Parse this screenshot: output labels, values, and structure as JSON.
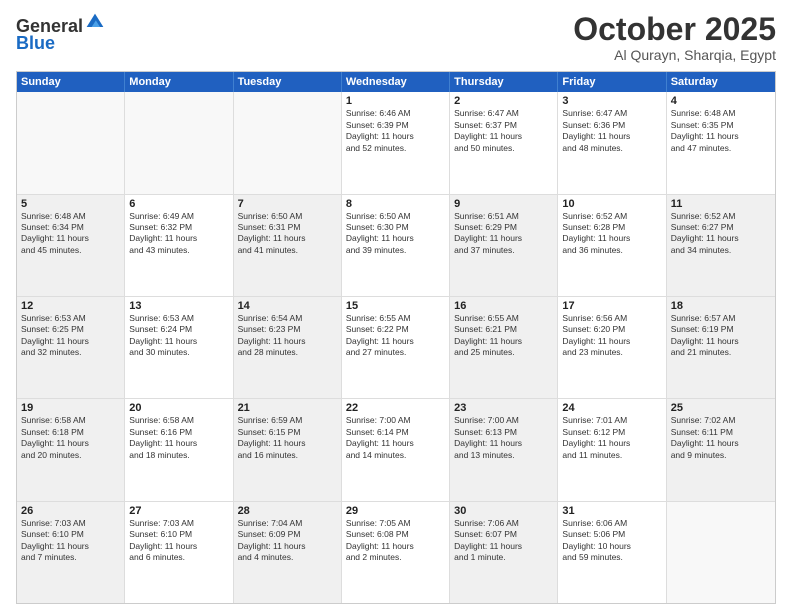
{
  "header": {
    "logo_general": "General",
    "logo_blue": "Blue",
    "month_title": "October 2025",
    "subtitle": "Al Qurayn, Sharqia, Egypt"
  },
  "calendar": {
    "days_of_week": [
      "Sunday",
      "Monday",
      "Tuesday",
      "Wednesday",
      "Thursday",
      "Friday",
      "Saturday"
    ],
    "rows": [
      [
        {
          "day": "",
          "info": "",
          "empty": true
        },
        {
          "day": "",
          "info": "",
          "empty": true
        },
        {
          "day": "",
          "info": "",
          "empty": true
        },
        {
          "day": "1",
          "info": "Sunrise: 6:46 AM\nSunset: 6:39 PM\nDaylight: 11 hours\nand 52 minutes."
        },
        {
          "day": "2",
          "info": "Sunrise: 6:47 AM\nSunset: 6:37 PM\nDaylight: 11 hours\nand 50 minutes."
        },
        {
          "day": "3",
          "info": "Sunrise: 6:47 AM\nSunset: 6:36 PM\nDaylight: 11 hours\nand 48 minutes."
        },
        {
          "day": "4",
          "info": "Sunrise: 6:48 AM\nSunset: 6:35 PM\nDaylight: 11 hours\nand 47 minutes."
        }
      ],
      [
        {
          "day": "5",
          "info": "Sunrise: 6:48 AM\nSunset: 6:34 PM\nDaylight: 11 hours\nand 45 minutes.",
          "shaded": true
        },
        {
          "day": "6",
          "info": "Sunrise: 6:49 AM\nSunset: 6:32 PM\nDaylight: 11 hours\nand 43 minutes."
        },
        {
          "day": "7",
          "info": "Sunrise: 6:50 AM\nSunset: 6:31 PM\nDaylight: 11 hours\nand 41 minutes.",
          "shaded": true
        },
        {
          "day": "8",
          "info": "Sunrise: 6:50 AM\nSunset: 6:30 PM\nDaylight: 11 hours\nand 39 minutes."
        },
        {
          "day": "9",
          "info": "Sunrise: 6:51 AM\nSunset: 6:29 PM\nDaylight: 11 hours\nand 37 minutes.",
          "shaded": true
        },
        {
          "day": "10",
          "info": "Sunrise: 6:52 AM\nSunset: 6:28 PM\nDaylight: 11 hours\nand 36 minutes."
        },
        {
          "day": "11",
          "info": "Sunrise: 6:52 AM\nSunset: 6:27 PM\nDaylight: 11 hours\nand 34 minutes.",
          "shaded": true
        }
      ],
      [
        {
          "day": "12",
          "info": "Sunrise: 6:53 AM\nSunset: 6:25 PM\nDaylight: 11 hours\nand 32 minutes.",
          "shaded": true
        },
        {
          "day": "13",
          "info": "Sunrise: 6:53 AM\nSunset: 6:24 PM\nDaylight: 11 hours\nand 30 minutes."
        },
        {
          "day": "14",
          "info": "Sunrise: 6:54 AM\nSunset: 6:23 PM\nDaylight: 11 hours\nand 28 minutes.",
          "shaded": true
        },
        {
          "day": "15",
          "info": "Sunrise: 6:55 AM\nSunset: 6:22 PM\nDaylight: 11 hours\nand 27 minutes."
        },
        {
          "day": "16",
          "info": "Sunrise: 6:55 AM\nSunset: 6:21 PM\nDaylight: 11 hours\nand 25 minutes.",
          "shaded": true
        },
        {
          "day": "17",
          "info": "Sunrise: 6:56 AM\nSunset: 6:20 PM\nDaylight: 11 hours\nand 23 minutes."
        },
        {
          "day": "18",
          "info": "Sunrise: 6:57 AM\nSunset: 6:19 PM\nDaylight: 11 hours\nand 21 minutes.",
          "shaded": true
        }
      ],
      [
        {
          "day": "19",
          "info": "Sunrise: 6:58 AM\nSunset: 6:18 PM\nDaylight: 11 hours\nand 20 minutes.",
          "shaded": true
        },
        {
          "day": "20",
          "info": "Sunrise: 6:58 AM\nSunset: 6:16 PM\nDaylight: 11 hours\nand 18 minutes."
        },
        {
          "day": "21",
          "info": "Sunrise: 6:59 AM\nSunset: 6:15 PM\nDaylight: 11 hours\nand 16 minutes.",
          "shaded": true
        },
        {
          "day": "22",
          "info": "Sunrise: 7:00 AM\nSunset: 6:14 PM\nDaylight: 11 hours\nand 14 minutes."
        },
        {
          "day": "23",
          "info": "Sunrise: 7:00 AM\nSunset: 6:13 PM\nDaylight: 11 hours\nand 13 minutes.",
          "shaded": true
        },
        {
          "day": "24",
          "info": "Sunrise: 7:01 AM\nSunset: 6:12 PM\nDaylight: 11 hours\nand 11 minutes."
        },
        {
          "day": "25",
          "info": "Sunrise: 7:02 AM\nSunset: 6:11 PM\nDaylight: 11 hours\nand 9 minutes.",
          "shaded": true
        }
      ],
      [
        {
          "day": "26",
          "info": "Sunrise: 7:03 AM\nSunset: 6:10 PM\nDaylight: 11 hours\nand 7 minutes.",
          "shaded": true
        },
        {
          "day": "27",
          "info": "Sunrise: 7:03 AM\nSunset: 6:10 PM\nDaylight: 11 hours\nand 6 minutes."
        },
        {
          "day": "28",
          "info": "Sunrise: 7:04 AM\nSunset: 6:09 PM\nDaylight: 11 hours\nand 4 minutes.",
          "shaded": true
        },
        {
          "day": "29",
          "info": "Sunrise: 7:05 AM\nSunset: 6:08 PM\nDaylight: 11 hours\nand 2 minutes."
        },
        {
          "day": "30",
          "info": "Sunrise: 7:06 AM\nSunset: 6:07 PM\nDaylight: 11 hours\nand 1 minute.",
          "shaded": true
        },
        {
          "day": "31",
          "info": "Sunrise: 6:06 AM\nSunset: 5:06 PM\nDaylight: 10 hours\nand 59 minutes."
        },
        {
          "day": "",
          "info": "",
          "empty": true
        }
      ]
    ]
  }
}
